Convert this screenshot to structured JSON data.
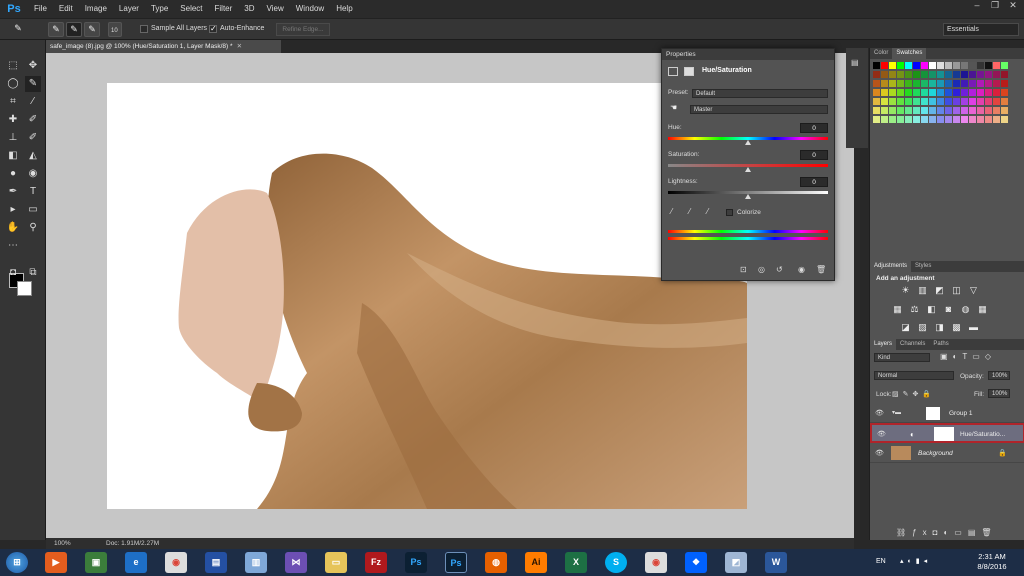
{
  "app": {
    "logo": "Ps"
  },
  "menu": [
    "File",
    "Edit",
    "Image",
    "Layer",
    "Type",
    "Select",
    "Filter",
    "3D",
    "View",
    "Window",
    "Help"
  ],
  "options": {
    "size_value": "10",
    "sample_all_layers": "Sample All Layers",
    "auto_enhance": "Auto-Enhance",
    "refine_edge": "Refine Edge...",
    "workspace": "Essentials"
  },
  "document": {
    "tab_title": "safe_image (8).jpg @ 100% (Hue/Saturation 1, Layer Mask/8) *",
    "zoom": "100%",
    "doc_info": "Doc: 1.91M/2.27M"
  },
  "properties": {
    "panel_title": "Properties",
    "adjustment": "Hue/Saturation",
    "preset_label": "Preset:",
    "preset_value": "Default",
    "channel_value": "Master",
    "hue_label": "Hue:",
    "hue_value": "0",
    "saturation_label": "Saturation:",
    "saturation_value": "0",
    "lightness_label": "Lightness:",
    "lightness_value": "0",
    "colorize_label": "Colorize",
    "hue_level": 0.5,
    "saturation_level": 0.5,
    "lightness_level": 0.5
  },
  "color_panel": {
    "tabs": [
      "Color",
      "Swatches"
    ],
    "active": "Swatches"
  },
  "adjustments_panel": {
    "tabs": [
      "Adjustments",
      "Styles"
    ],
    "heading": "Add an adjustment"
  },
  "layers_panel": {
    "tabs": [
      "Layers",
      "Channels",
      "Paths"
    ],
    "filter": "Kind",
    "blend_mode": "Normal",
    "opacity_label": "Opacity:",
    "opacity_value": "100%",
    "lock_label": "Lock:",
    "fill_label": "Fill:",
    "fill_value": "100%",
    "layers": [
      {
        "name": "Group 1"
      },
      {
        "name": "Hue/Saturatio..."
      },
      {
        "name": "Background"
      }
    ]
  },
  "taskbar": {
    "language": "EN",
    "time": "2:31 AM",
    "date": "8/8/2016"
  },
  "colors": {
    "accent": "#31a8ff",
    "selected_layer_border": "#b0242a",
    "hair": "#b88a5c"
  }
}
